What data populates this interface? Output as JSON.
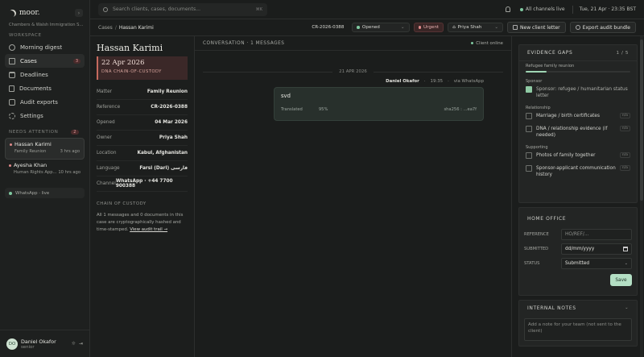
{
  "brand": {
    "name": "moor.",
    "firm": "Chambers & Walsh Immigration S..."
  },
  "sidebar": {
    "workspace_label": "WORKSPACE",
    "items": [
      {
        "label": "Morning digest",
        "icon": "sun-icon"
      },
      {
        "label": "Cases",
        "icon": "briefcase-icon",
        "badge": "3"
      },
      {
        "label": "Deadlines",
        "icon": "calendar-icon"
      },
      {
        "label": "Documents",
        "icon": "document-icon"
      },
      {
        "label": "Audit exports",
        "icon": "checkbox-icon"
      },
      {
        "label": "Settings",
        "icon": "gear-icon"
      }
    ],
    "attention_label": "NEEDS ATTENTION",
    "attention_count": "2",
    "attention": [
      {
        "name": "Hassan Karimi",
        "sub": "Family Reunion",
        "time": "3 hrs ago"
      },
      {
        "name": "Ayesha Khan",
        "sub": "Human Rights App...",
        "time": "10 hrs ago"
      }
    ],
    "whatsapp": "WhatsApp · live",
    "user": {
      "initials": "DO",
      "name": "Daniel Okafor",
      "role": "senior"
    }
  },
  "topbar": {
    "search_placeholder": "Search clients, cases, documents...",
    "search_shortcut": "⌘K",
    "channels": "All channels live",
    "datetime": "Tue, 21 Apr · 23:35 BST"
  },
  "case_header": {
    "crumb_root": "Cases",
    "crumb_current": "Hassan Karimi",
    "ref": "CR-2026-0388",
    "status": "Opened",
    "priority": "Urgent",
    "owner": "Priya Shah",
    "new_letter": "New client letter",
    "export": "Export audit bundle"
  },
  "client": {
    "name": "Hassan Karimi",
    "date": "22 Apr 2026",
    "date_sub": "DNA CHAIN-OF-CUSTODY",
    "fields": [
      {
        "k": "Matter",
        "v": "Family Reunion"
      },
      {
        "k": "Reference",
        "v": "CR-2026-0388"
      },
      {
        "k": "Opened",
        "v": "04 Mar 2026"
      },
      {
        "k": "Owner",
        "v": "Priya Shah"
      },
      {
        "k": "Location",
        "v": "Kabul, Afghanistan"
      },
      {
        "k": "Language",
        "v": "Farsi (Dari) فارسی"
      },
      {
        "k": "Channel",
        "v": "WhatsApp · +44 7700 900388"
      }
    ],
    "chain_title": "CHAIN OF CUSTODY",
    "chain_text": "All 1 messages and 0 documents in this case are cryptographically hashed and time-stamped.",
    "chain_link": "View audit trail →"
  },
  "conversation": {
    "title": "CONVERSATION · 1 MESSAGES",
    "client_status": "Client online",
    "day": "21 APR 2026",
    "message": {
      "author": "Daniel Okafor",
      "time": "19:35",
      "via": "via WhatsApp",
      "text": "svd",
      "translated_label": "Translated",
      "confidence": "95%",
      "hash": "sha256 : ...ea7f"
    }
  },
  "evidence": {
    "title": "EVIDENCE GAPS",
    "count": "1 / 5",
    "progress": 0.2,
    "subtitle": "Refugee family reunion",
    "groups": [
      {
        "label": "Sponsor",
        "items": [
          {
            "text": "Sponsor: refugee / humanitarian status letter",
            "checked": true,
            "na": ""
          }
        ]
      },
      {
        "label": "Relationship",
        "items": [
          {
            "text": "Marriage / birth certificates",
            "checked": false,
            "na": "n/a"
          },
          {
            "text": "DNA / relationship evidence (if needed)",
            "checked": false,
            "na": "n/a"
          }
        ]
      },
      {
        "label": "Supporting",
        "items": [
          {
            "text": "Photos of family together",
            "checked": false,
            "na": "n/a"
          },
          {
            "text": "Sponsor-applicant communication history",
            "checked": false,
            "na": "n/a"
          }
        ]
      }
    ]
  },
  "home_office": {
    "title": "HOME OFFICE",
    "reference_label": "REFERENCE",
    "reference_placeholder": "HO/REF/...",
    "submitted_label": "SUBMITTED",
    "submitted_placeholder": "dd/mm/yyyy",
    "status_label": "STATUS",
    "status_value": "Submitted",
    "save": "Save"
  },
  "notes": {
    "title": "INTERNAL NOTES",
    "placeholder": "Add a note for your team (not sent to the client)"
  },
  "colors": {
    "accent": "#8fcaa4",
    "urgent": "#e08a8a",
    "background": "#1b1d1c"
  }
}
